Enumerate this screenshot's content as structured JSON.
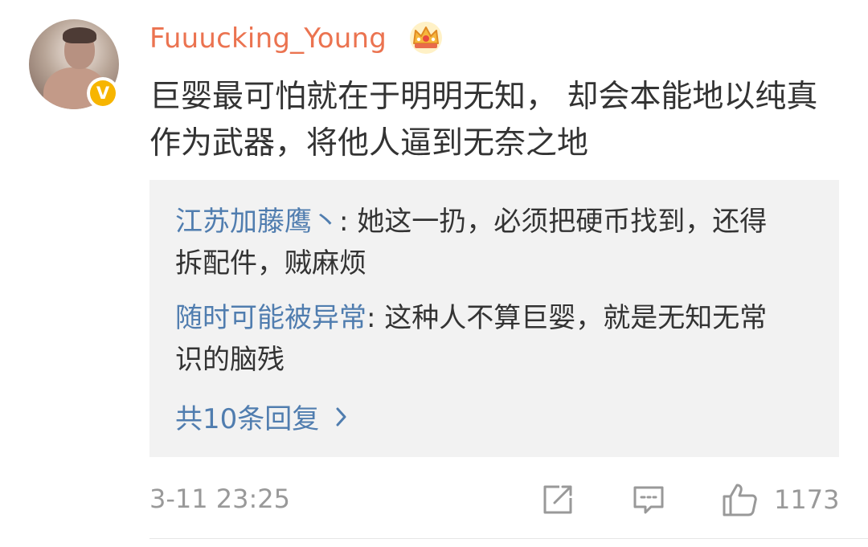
{
  "comment": {
    "username": "Fuuucking_Young",
    "text": "巨婴最可怕就在于明明无知， 却会本能地以纯真作为武器，将他人逼到无奈之地",
    "timestamp": "3-11 23:25",
    "like_count": "1173",
    "verified_badge": "V"
  },
  "replies": [
    {
      "author": "江苏加藤鹰丶",
      "separator": ": ",
      "text": "她这一扔，必须把硬币找到，还得拆配件，贼麻烦"
    },
    {
      "author": "随时可能被异常",
      "separator": ": ",
      "text": "这种人不算巨婴，就是无知无常识的脑残"
    }
  ],
  "more_replies": "共10条回复",
  "icons": {
    "crown": "crown-icon",
    "share": "share-icon",
    "comment": "comment-icon",
    "like": "thumbs-up-icon",
    "more": "chevron-right-icon"
  },
  "colors": {
    "username": "#eb7350",
    "reply_author": "#507daf",
    "body_text": "#333333",
    "meta_text": "#999999",
    "reply_bg": "#f2f2f2",
    "verified": "#f7b500"
  }
}
